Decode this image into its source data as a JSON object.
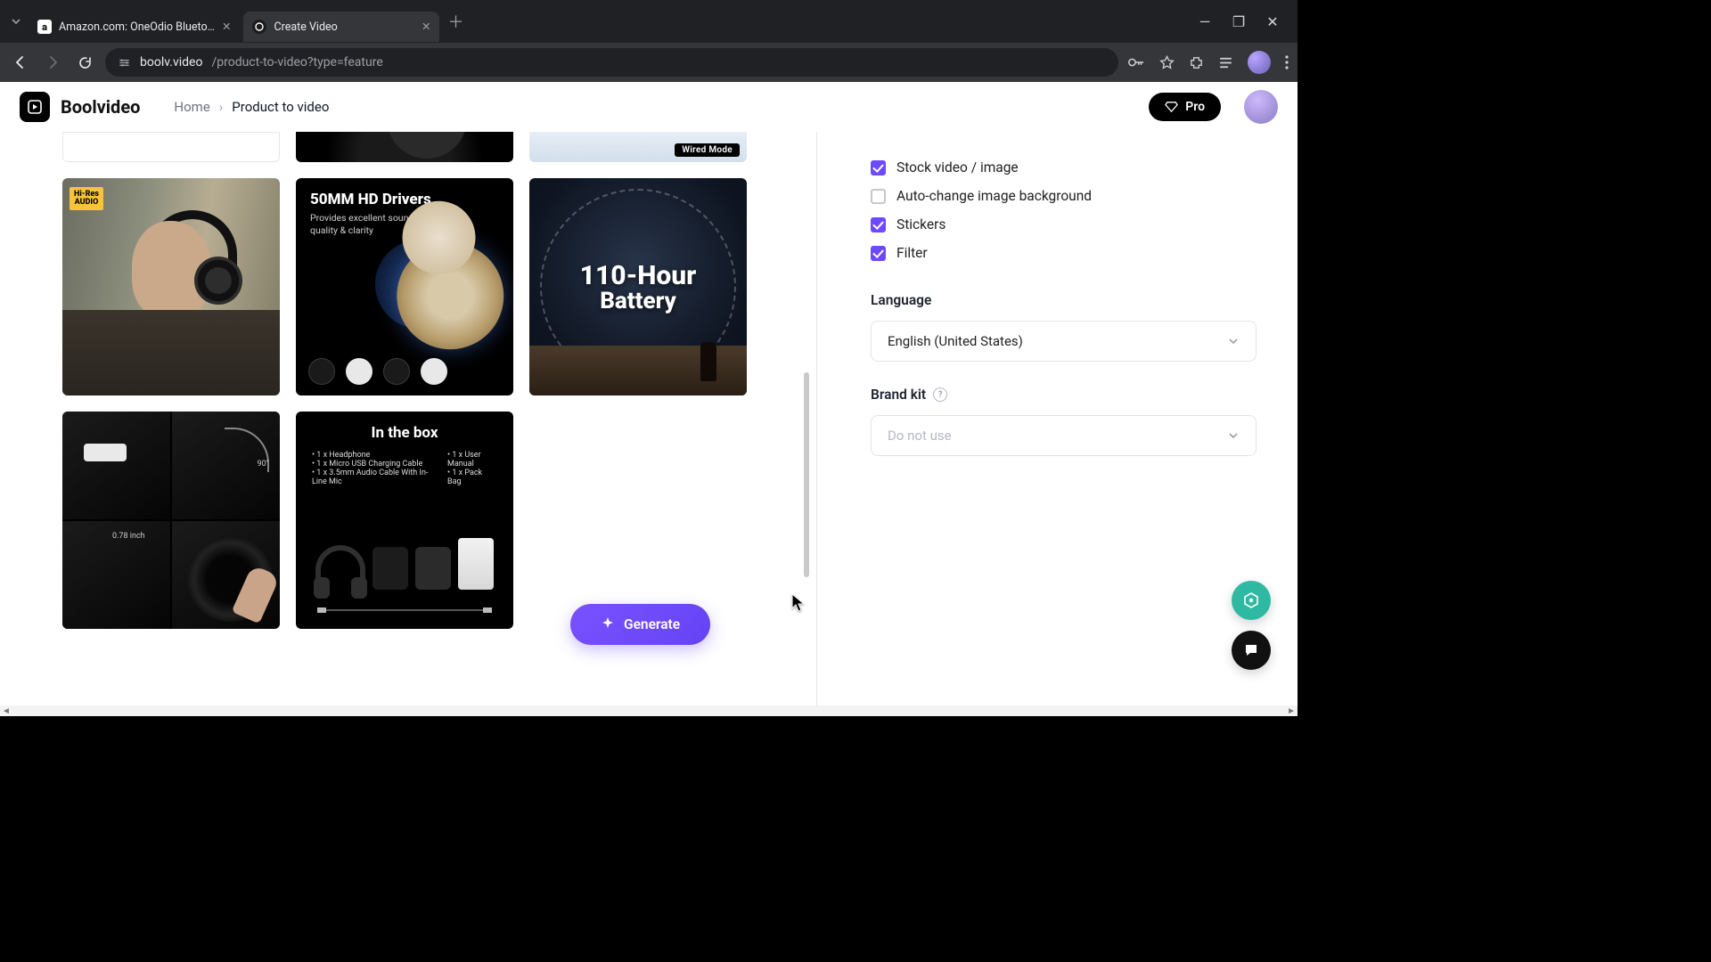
{
  "browser": {
    "tabs": [
      {
        "title": "Amazon.com: OneOdio Blueto…"
      },
      {
        "title": "Create Video"
      }
    ],
    "url_host": "boolv.video",
    "url_path": "/product-to-video?type=feature"
  },
  "app": {
    "brand": "Boolvideo",
    "breadcrumb_home": "Home",
    "breadcrumb_current": "Product to video",
    "pro_label": "Pro"
  },
  "images": {
    "peek3_badge": "Wired Mode",
    "hires_line1": "Hi-Res",
    "hires_line2": "AUDIO",
    "drivers_title": "50MM HD Drivers",
    "drivers_sub": "Provides excellent sound quality & clarity",
    "battery_line1": "110-Hour",
    "battery_line2": "Battery",
    "details_ninety": "90°",
    "details_inch": "0.78 inch",
    "box_title": "In the box",
    "box_left": [
      "1 x Headphone",
      "1 x Micro USB Charging Cable",
      "1 x 3.5mm Audio Cable With In-Line Mic"
    ],
    "box_right": [
      "1 x User Manual",
      "1 x Pack Bag"
    ]
  },
  "generate_label": "Generate",
  "options": {
    "stock": {
      "label": "Stock video / image",
      "checked": true
    },
    "autobg": {
      "label": "Auto-change image background",
      "checked": false
    },
    "stickers": {
      "label": "Stickers",
      "checked": true
    },
    "filter": {
      "label": "Filter",
      "checked": true
    }
  },
  "language": {
    "label": "Language",
    "value": "English (United States)"
  },
  "brandkit": {
    "label": "Brand kit",
    "value": "Do not use"
  }
}
